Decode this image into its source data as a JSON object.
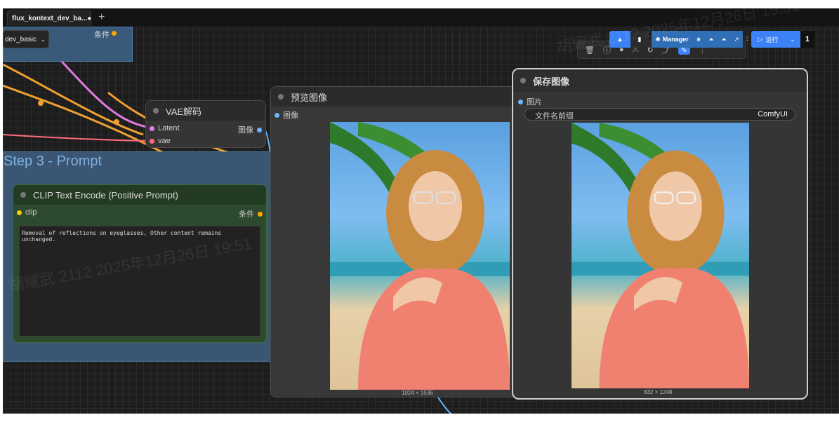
{
  "tabs": [
    {
      "label": "flux_kontext_dev_ba...",
      "modified_marker": "●"
    }
  ],
  "add_tab_label": "+",
  "top_group": {
    "dropdown_value": "dev_basic",
    "output_label": "条件"
  },
  "step3_group": {
    "title": "Step 3 - Prompt"
  },
  "vae_node": {
    "title": "VAE解码",
    "inputs": [
      {
        "label": "Latent",
        "color": "#f07af0"
      },
      {
        "label": "vae",
        "color": "#ff6b7a"
      }
    ],
    "output": {
      "label": "图像",
      "color": "#6ab7ff"
    }
  },
  "clip_node": {
    "title": "CLIP Text Encode (Positive Prompt)",
    "input": {
      "label": "clip",
      "color": "#f5d000"
    },
    "output": {
      "label": "条件",
      "color": "#ffa500"
    },
    "prompt_text": "Removal of reflections on eyeglasses, Other content remains unchanged."
  },
  "preview_node": {
    "title": "预览图像",
    "input": {
      "label": "图像",
      "color": "#6ab7ff"
    },
    "image_size": "1024 × 1536"
  },
  "save_node": {
    "title": "保存图像",
    "input": {
      "label": "图片",
      "color": "#6ab7ff"
    },
    "filename_prefix_label": "文件名前缀",
    "filename_prefix_value": "ComfyUI",
    "image_size": "832 × 1248"
  },
  "toolbar": {
    "manager_label": "Manager",
    "run_label": "运行",
    "queue_count": "1",
    "accent": "#3b82f6"
  },
  "watermarks": [
    "胡耀武 2112 2025年12月26日 19:51"
  ]
}
